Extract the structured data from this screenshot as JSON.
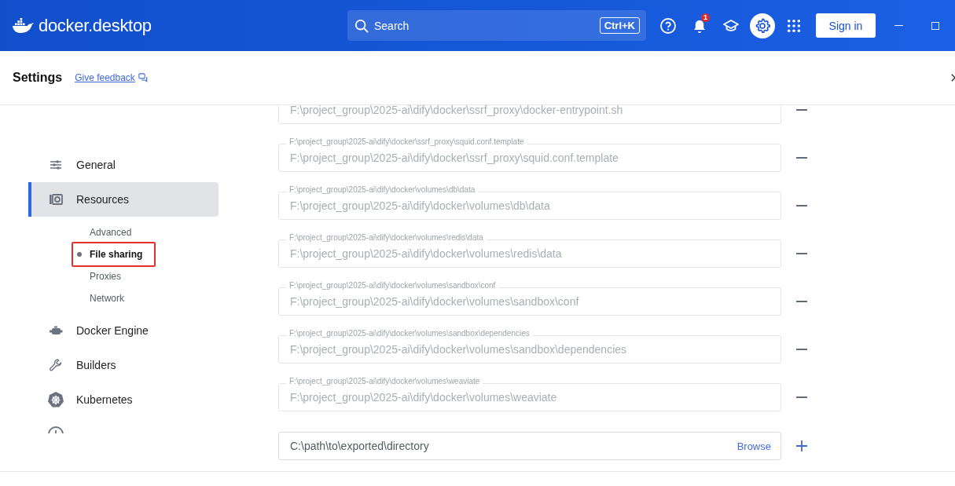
{
  "header": {
    "wordmark": "docker.desktop",
    "search": {
      "placeholder": "Search",
      "shortcut": "Ctrl+K"
    },
    "toolbar": [
      {
        "kind": "help",
        "selected": false
      },
      {
        "kind": "notifications",
        "selected": false,
        "badge": "1"
      },
      {
        "kind": "learn",
        "selected": false
      },
      {
        "kind": "settings",
        "selected": true
      },
      {
        "kind": "extensions",
        "selected": false
      }
    ],
    "sign_in": "Sign in"
  },
  "settings_bar": {
    "title": "Settings",
    "feedback_link": "Give feedback"
  },
  "sidebar": {
    "items": [
      {
        "label": "General",
        "kind": "general",
        "selected": false
      },
      {
        "label": "Resources",
        "kind": "resources",
        "selected": true,
        "children": [
          {
            "label": "Advanced",
            "selected": false
          },
          {
            "label": "File sharing",
            "selected": true
          },
          {
            "label": "Proxies",
            "selected": false
          },
          {
            "label": "Network",
            "selected": false
          }
        ]
      },
      {
        "label": "Docker Engine",
        "kind": "engine",
        "selected": false
      },
      {
        "label": "Builders",
        "kind": "builders",
        "selected": false
      },
      {
        "label": "Kubernetes",
        "kind": "kubernetes",
        "selected": false
      },
      {
        "kind": "updates",
        "selected": false
      }
    ]
  },
  "file_sharing": {
    "shares": [
      {
        "value": "F:\\project_group\\2025-ai\\dify\\docker\\ssrf_proxy\\docker-entrypoint.sh"
      },
      {
        "label": "F:\\project_group\\2025-ai\\dify\\docker\\ssrf_proxy\\squid.conf.template",
        "value": "F:\\project_group\\2025-ai\\dify\\docker\\ssrf_proxy\\squid.conf.template"
      },
      {
        "label": "F:\\project_group\\2025-ai\\dify\\docker\\volumes\\db\\data",
        "value": "F:\\project_group\\2025-ai\\dify\\docker\\volumes\\db\\data"
      },
      {
        "label": "F:\\project_group\\2025-ai\\dify\\docker\\volumes\\redis\\data",
        "value": "F:\\project_group\\2025-ai\\dify\\docker\\volumes\\redis\\data"
      },
      {
        "label": "F:\\project_group\\2025-ai\\dify\\docker\\volumes\\sandbox\\conf",
        "value": "F:\\project_group\\2025-ai\\dify\\docker\\volumes\\sandbox\\conf"
      },
      {
        "label": "F:\\project_group\\2025-ai\\dify\\docker\\volumes\\sandbox\\dependencies",
        "value": "F:\\project_group\\2025-ai\\dify\\docker\\volumes\\sandbox\\dependencies"
      },
      {
        "label": "F:\\project_group\\2025-ai\\dify\\docker\\volumes\\weaviate",
        "value": "F:\\project_group\\2025-ai\\dify\\docker\\volumes\\weaviate"
      }
    ],
    "add": {
      "placeholder": "C:\\path\\to\\exported\\directory",
      "browse": "Browse"
    }
  }
}
